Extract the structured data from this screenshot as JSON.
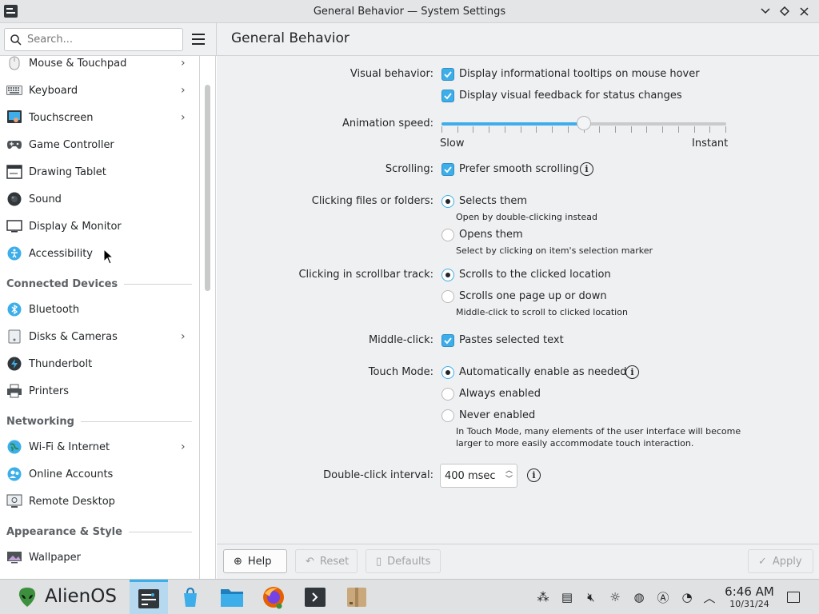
{
  "window": {
    "title": "General Behavior — System Settings",
    "buttons": [
      "minimize",
      "maximize",
      "close"
    ]
  },
  "header": {
    "search_placeholder": "Search...",
    "page_title": "General Behavior"
  },
  "sidebar": {
    "items": [
      {
        "label": "Mouse & Touchpad",
        "icon": "mouse-icon",
        "has_submenu": true
      },
      {
        "label": "Keyboard",
        "icon": "keyboard-icon",
        "has_submenu": true
      },
      {
        "label": "Touchscreen",
        "icon": "touchscreen-icon",
        "has_submenu": true
      },
      {
        "label": "Game Controller",
        "icon": "gamepad-icon",
        "has_submenu": false
      },
      {
        "label": "Drawing Tablet",
        "icon": "tablet-icon",
        "has_submenu": false
      },
      {
        "label": "Sound",
        "icon": "speaker-icon",
        "has_submenu": false
      },
      {
        "label": "Display & Monitor",
        "icon": "monitor-icon",
        "has_submenu": false
      },
      {
        "label": "Accessibility",
        "icon": "accessibility-icon",
        "has_submenu": false
      }
    ],
    "categories": {
      "connected_devices": "Connected Devices",
      "networking": "Networking",
      "appearance": "Appearance & Style"
    },
    "connected_items": [
      {
        "label": "Bluetooth",
        "icon": "bluetooth-icon",
        "has_submenu": false
      },
      {
        "label": "Disks & Cameras",
        "icon": "disk-icon",
        "has_submenu": true
      },
      {
        "label": "Thunderbolt",
        "icon": "thunderbolt-icon",
        "has_submenu": false
      },
      {
        "label": "Printers",
        "icon": "printer-icon",
        "has_submenu": false
      }
    ],
    "networking_items": [
      {
        "label": "Wi-Fi & Internet",
        "icon": "globe-icon",
        "has_submenu": true
      },
      {
        "label": "Online Accounts",
        "icon": "accounts-icon",
        "has_submenu": false
      },
      {
        "label": "Remote Desktop",
        "icon": "remote-desktop-icon",
        "has_submenu": false
      }
    ],
    "appearance_items": [
      {
        "label": "Wallpaper",
        "icon": "wallpaper-icon",
        "has_submenu": false
      }
    ]
  },
  "settings": {
    "visual_behavior": {
      "label": "Visual behavior:",
      "opt1": "Display informational tooltips on mouse hover",
      "opt1_checked": true,
      "opt2": "Display visual feedback for status changes",
      "opt2_checked": true
    },
    "animation_speed": {
      "label": "Animation speed:",
      "min_label": "Slow",
      "max_label": "Instant",
      "value_fraction": 0.5
    },
    "scrolling": {
      "label": "Scrolling:",
      "opt": "Prefer smooth scrolling",
      "checked": true
    },
    "clicking_files": {
      "label": "Clicking files or folders:",
      "opt1": "Selects them",
      "opt1_hint": "Open by double-clicking instead",
      "opt2": "Opens them",
      "opt2_hint": "Select by clicking on item's selection marker",
      "selected": 1
    },
    "scrollbar_track": {
      "label": "Clicking in scrollbar track:",
      "opt1": "Scrolls to the clicked location",
      "opt2": "Scrolls one page up or down",
      "opt2_hint": "Middle-click to scroll to clicked location",
      "selected": 1
    },
    "middle_click": {
      "label": "Middle-click:",
      "opt": "Pastes selected text",
      "checked": true
    },
    "touch_mode": {
      "label": "Touch Mode:",
      "opt1": "Automatically enable as needed",
      "opt2": "Always enabled",
      "opt3": "Never enabled",
      "hint_line1": "In Touch Mode, many elements of the user interface will become",
      "hint_line2": "larger to more easily accommodate touch interaction.",
      "selected": 1
    },
    "double_click": {
      "label": "Double-click interval:",
      "value": "400 msec"
    }
  },
  "footer": {
    "help": "Help",
    "reset": "Reset",
    "defaults": "Defaults",
    "apply": "Apply"
  },
  "taskbar": {
    "os_name": "AlienOS",
    "time": "6:46 AM",
    "date": "10/31/24",
    "apps": [
      "system-settings-icon",
      "discover-icon",
      "file-manager-icon",
      "firefox-icon",
      "terminal-icon",
      "archive-icon"
    ],
    "tray": [
      "network-share-icon",
      "clipboard-icon",
      "volume-muted-icon",
      "brightness-icon",
      "globe-icon",
      "input-method-icon",
      "performance-icon",
      "show-hidden-icon"
    ]
  }
}
